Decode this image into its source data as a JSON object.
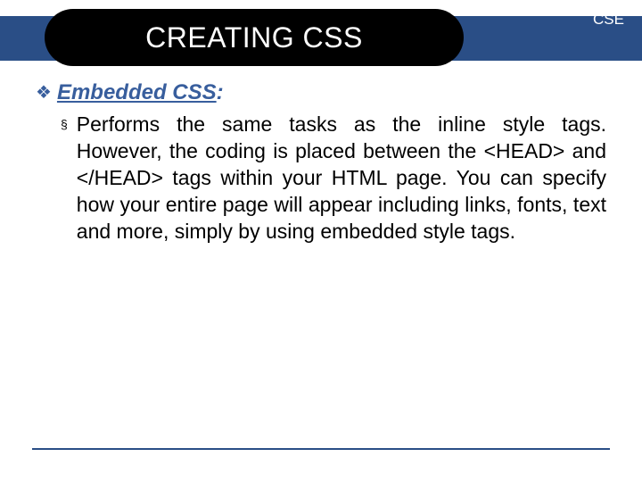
{
  "header": {
    "title": "CREATING CSS",
    "badge": "CSE"
  },
  "content": {
    "heading": "Embedded CSS",
    "heading_suffix": ":",
    "body": "Performs the same tasks as the inline style tags. However, the coding is placed between the <HEAD> and </HEAD> tags within your HTML page. You can specify how your entire page will appear including links, fonts, text and more, simply by using embedded style tags."
  }
}
